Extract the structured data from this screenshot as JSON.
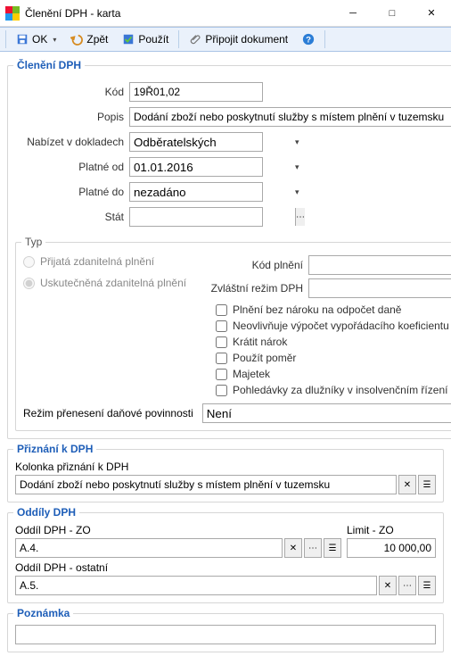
{
  "window": {
    "title": "Členění DPH - karta"
  },
  "toolbar": {
    "ok": "OK",
    "back": "Zpět",
    "use": "Použít",
    "attach": "Připojit dokument"
  },
  "section1": {
    "legend": "Členění DPH",
    "kod_label": "Kód",
    "kod_value": "19Ř01,02",
    "popis_label": "Popis",
    "popis_value": "Dodání zboží nebo poskytnutí služby s místem plnění v tuzemsku",
    "nabizet_label": "Nabízet v dokladech",
    "nabizet_value": "Odběratelských",
    "platne_od_label": "Platné od",
    "platne_od_value": "01.01.2016",
    "platne_do_label": "Platné do",
    "platne_do_value": "nezadáno",
    "stat_label": "Stát",
    "stat_value": ""
  },
  "typ": {
    "legend": "Typ",
    "radio1": "Přijatá zdanitelná plnění",
    "radio2": "Uskutečněná zdanitelná plnění",
    "kod_plneni_label": "Kód plnění",
    "kod_plneni_value": "",
    "zvlastni_label": "Zvláštní režim DPH",
    "zvlastni_value": "",
    "chk1": "Plnění bez nároku na odpočet daně",
    "chk2": "Neovlivňuje výpočet vypořádacího koeficientu",
    "chk3": "Krátit nárok",
    "chk4": "Použít poměr",
    "chk5": "Majetek",
    "chk6": "Pohledávky za dlužníky v insolvenčním řízení",
    "rezim_label": "Režim přenesení daňové povinnosti",
    "rezim_value": "Není"
  },
  "priznani": {
    "legend": "Přiznání k DPH",
    "kolonka_label": "Kolonka přiznání k DPH",
    "kolonka_value": "Dodání zboží nebo poskytnutí služby s místem plnění v tuzemsku"
  },
  "oddily": {
    "legend": "Oddíly DPH",
    "zo_label": "Oddíl DPH - ZO",
    "zo_value": "A.4.",
    "limit_label": "Limit - ZO",
    "limit_value": "10 000,00",
    "ostatni_label": "Oddíl DPH - ostatní",
    "ostatni_value": "A.5."
  },
  "poznamka": {
    "legend": "Poznámka",
    "value": ""
  }
}
